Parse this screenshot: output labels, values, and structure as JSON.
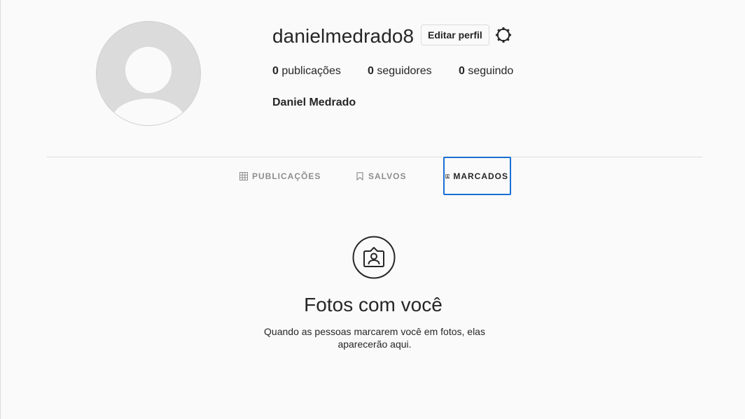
{
  "profile": {
    "username": "danielmedrado8",
    "edit_label": "Editar perfil",
    "settings_icon": "gear-icon",
    "full_name": "Daniel Medrado",
    "avatar_icon": "default-avatar-icon"
  },
  "stats": {
    "posts_count": "0",
    "posts_label": " publicações",
    "followers_count": "0",
    "followers_label": " seguidores",
    "following_count": "0",
    "following_label": " seguindo"
  },
  "tabs": [
    {
      "label": "PUBLICAÇÕES",
      "icon": "grid-icon",
      "active": false
    },
    {
      "label": "SALVOS",
      "icon": "bookmark-icon",
      "active": false
    },
    {
      "label": "MARCADOS",
      "icon": "tagged-icon",
      "active": true
    }
  ],
  "empty_state": {
    "icon": "tagged-photo-icon",
    "title": "Fotos com você",
    "description": "Quando as pessoas marcarem você em fotos, elas aparecerão aqui."
  },
  "colors": {
    "background": "#fafafa",
    "text": "#262626",
    "muted": "#8e8e8e",
    "border": "#dbdbdb",
    "focus_outline": "#1a6fd4"
  }
}
